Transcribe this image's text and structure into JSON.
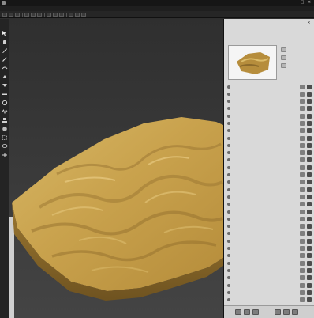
{
  "window": {
    "app_title": "",
    "document_title": "",
    "controls": {
      "minimize": "–",
      "maximize": "□",
      "close": "×"
    }
  },
  "menu": [
    "",
    "",
    "",
    "",
    "",
    "",
    "",
    "",
    ""
  ],
  "toolbar": {
    "button_count": 12
  },
  "tools": [
    "cursor-icon",
    "hand-icon",
    "brush-icon",
    "pencil-icon",
    "smooth-icon",
    "raise-icon",
    "lower-icon",
    "flatten-icon",
    "erode-icon",
    "noise-icon",
    "stamp-icon",
    "paint-icon",
    "select-icon",
    "lasso-icon",
    "transform-icon",
    "grid-icon",
    "eye-icon",
    "camera-icon"
  ],
  "panel": {
    "title": "",
    "info_lines": [
      "",
      "",
      ""
    ],
    "close": "×",
    "properties": [
      "",
      "",
      "",
      "",
      "",
      "",
      "",
      "",
      "",
      "",
      "",
      "",
      "",
      "",
      "",
      "",
      "",
      "",
      "",
      "",
      "",
      "",
      "",
      "",
      "",
      "",
      "",
      "",
      "",
      ""
    ]
  },
  "colors": {
    "terrain_light": "#d4b35c",
    "terrain_mid": "#b89140",
    "terrain_dark": "#8a6a2a",
    "viewport_bg": "#3a3a3a",
    "panel_bg": "#d9d9d9"
  }
}
